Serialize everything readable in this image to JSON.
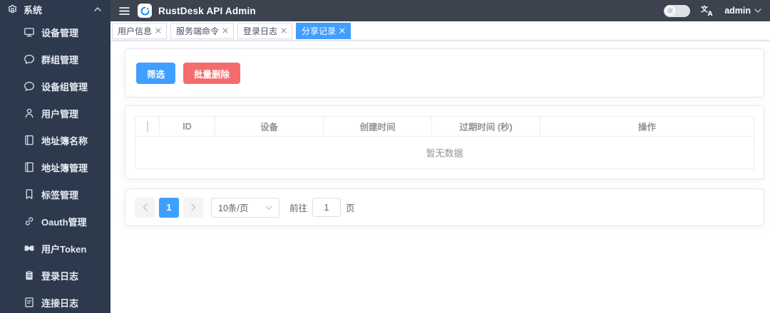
{
  "colors": {
    "primary": "#409EFF",
    "danger": "#F56C6C",
    "sidebar_bg": "#2D3A4D",
    "topbar_bg": "#3C424E"
  },
  "sidebar": {
    "root": {
      "label": "系统",
      "icon": "gear-icon"
    },
    "items": [
      {
        "label": "设备管理",
        "icon": "monitor-icon"
      },
      {
        "label": "群组管理",
        "icon": "chat-icon"
      },
      {
        "label": "设备组管理",
        "icon": "chat-icon"
      },
      {
        "label": "用户管理",
        "icon": "user-icon"
      },
      {
        "label": "地址簿名称",
        "icon": "address-book-icon"
      },
      {
        "label": "地址簿管理",
        "icon": "address-book-icon"
      },
      {
        "label": "标签管理",
        "icon": "bookmark-icon"
      },
      {
        "label": "Oauth管理",
        "icon": "link-icon"
      },
      {
        "label": "用户Token",
        "icon": "ticket-icon"
      },
      {
        "label": "登录日志",
        "icon": "clipboard-icon"
      },
      {
        "label": "连接日志",
        "icon": "document-icon"
      }
    ]
  },
  "header": {
    "title": "RustDesk API Admin",
    "user": "admin"
  },
  "tabs": [
    {
      "label": "用户信息",
      "active": false
    },
    {
      "label": "服务端命令",
      "active": false
    },
    {
      "label": "登录日志",
      "active": false
    },
    {
      "label": "分享记录",
      "active": true
    }
  ],
  "toolbar": {
    "filter_label": "筛选",
    "bulk_delete_label": "批量删除"
  },
  "table": {
    "headers": [
      "ID",
      "设备",
      "创建时间",
      "过期时间 (秒)",
      "操作"
    ],
    "rows": [],
    "empty_text": "暂无数据"
  },
  "pagination": {
    "current_page": "1",
    "page_size_label": "10条/页",
    "goto_label": "前往",
    "goto_value": "1",
    "page_unit_label": "页"
  }
}
